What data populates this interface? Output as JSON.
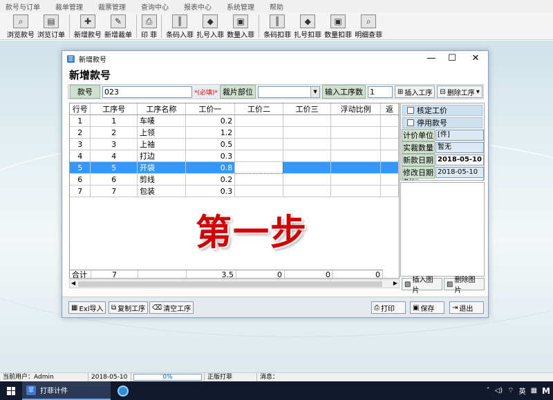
{
  "menu": [
    "款号与订单",
    "裁单管理",
    "裁票管理",
    "查询中心",
    "报表中心",
    "系统管理",
    "帮助"
  ],
  "toolbar": [
    {
      "label": "浏览款号",
      "icon": "magnifier-icon"
    },
    {
      "label": "浏览订单",
      "icon": "folder-icon"
    },
    {
      "sep": true
    },
    {
      "label": "新增款号",
      "icon": "add-document-icon"
    },
    {
      "label": "新增裁单",
      "icon": "edit-document-icon"
    },
    {
      "sep": true
    },
    {
      "label": "印 菲",
      "icon": "printer-icon"
    },
    {
      "sep": true
    },
    {
      "label": "条码入菲",
      "icon": "barcode-in-icon"
    },
    {
      "label": "扎号入菲",
      "icon": "bundle-in-icon"
    },
    {
      "label": "数量入菲",
      "icon": "quantity-in-icon"
    },
    {
      "sep": true
    },
    {
      "label": "条码扣菲",
      "icon": "barcode-out-icon"
    },
    {
      "label": "扎号扣菲",
      "icon": "bundle-out-icon"
    },
    {
      "label": "数量扣菲",
      "icon": "quantity-out-icon"
    },
    {
      "label": "明细查菲",
      "icon": "detail-search-icon"
    }
  ],
  "dialog": {
    "title": "新增款号",
    "heading": "新增款号",
    "style_label": "款号",
    "style_value": "023",
    "required_text": "*(必填)*",
    "cut_part_label": "裁片部位",
    "cut_part_value": "",
    "process_count_label": "输入工序数",
    "process_count_value": "1",
    "insert_process": "插入工序",
    "delete_process": "删除工序"
  },
  "grid": {
    "columns": [
      "行号",
      "工序号",
      "工序名称",
      "工价一",
      "工价二",
      "工价三",
      "浮动比例",
      "返"
    ],
    "rows": [
      {
        "row": "1",
        "proc": "1",
        "name": "车唛",
        "p1": "0.2",
        "p2": "",
        "p3": "",
        "float": ""
      },
      {
        "row": "2",
        "proc": "2",
        "name": "上领",
        "p1": "1.2",
        "p2": "",
        "p3": "",
        "float": ""
      },
      {
        "row": "3",
        "proc": "3",
        "name": "上袖",
        "p1": "0.5",
        "p2": "",
        "p3": "",
        "float": ""
      },
      {
        "row": "4",
        "proc": "4",
        "name": "打边",
        "p1": "0.3",
        "p2": "",
        "p3": "",
        "float": ""
      },
      {
        "row": "5",
        "proc": "5",
        "name": "开袋",
        "p1": "0.8",
        "p2": "",
        "p3": "",
        "float": "",
        "selected": true
      },
      {
        "row": "6",
        "proc": "6",
        "name": "剪线",
        "p1": "0.2",
        "p2": "",
        "p3": "",
        "float": ""
      },
      {
        "row": "7",
        "proc": "7",
        "name": "包装",
        "p1": "0.3",
        "p2": "",
        "p3": "",
        "float": ""
      }
    ],
    "totals": {
      "label": "合计",
      "proc": "7",
      "name": "",
      "p1": "3.5",
      "p2": "0",
      "p3": "0",
      "float": "0"
    }
  },
  "overlay_text": "第一步",
  "panel": {
    "check_price": "核定工价",
    "disable_style": "停用款号",
    "unit_label": "计价单位",
    "unit_value": "[件]",
    "cut_qty_label": "实裁数量",
    "cut_qty_value": "暂无",
    "new_date_label": "新款日期",
    "new_date_value": "2018-05-10",
    "mod_date_label": "修改日期",
    "mod_date_value": "2018-05-10",
    "note_label": "备注",
    "insert_image": "插入图片",
    "delete_image": "删除图片"
  },
  "bottom": {
    "excel_import": "Exl导入",
    "copy_process": "复制工序",
    "clear_process": "清空工序",
    "print": "打印",
    "save": "保存",
    "exit": "退出"
  },
  "status": {
    "user": "当前用户：Admin",
    "date": "2018-05-10",
    "progress": "0%",
    "progress_value": 0,
    "edition": "正版打菲",
    "message": "消息："
  },
  "taskbar": {
    "app": "打菲计件",
    "tray_lang": "英",
    "tray_ime": "M"
  }
}
